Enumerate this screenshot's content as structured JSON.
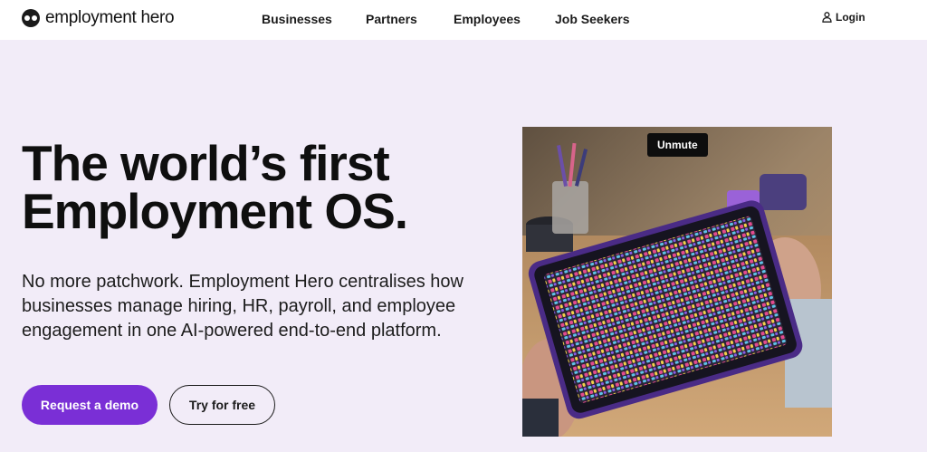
{
  "header": {
    "logo_text": "employment hero",
    "nav": [
      {
        "label": "Businesses"
      },
      {
        "label": "Partners"
      },
      {
        "label": "Employees"
      },
      {
        "label": "Job Seekers"
      }
    ],
    "login_label": "Login"
  },
  "hero": {
    "headline_line1": "The world’s first",
    "headline_line2": "Employment OS.",
    "subcopy": "No more patchwork. Employment Hero centralises how businesses manage hiring, HR, payroll, and employee engagement in one AI-powered end-to-end platform.",
    "primary_cta": "Request a demo",
    "secondary_cta": "Try for free"
  },
  "video": {
    "unmute_label": "Unmute"
  },
  "colors": {
    "background": "#f2ecf8",
    "accent": "#7a2fd6",
    "header_bg": "#ffffff"
  },
  "icons": {
    "logo": "employment-hero-logo",
    "login": "user-icon"
  }
}
